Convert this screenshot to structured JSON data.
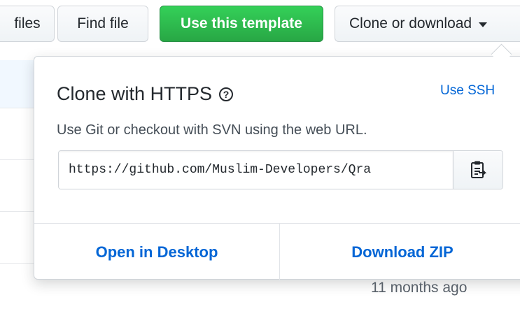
{
  "toolbar": {
    "files_label": "files",
    "find_file_label": "Find file",
    "use_template_label": "Use this template",
    "clone_label": "Clone or download",
    "clone_icon": "caret-down-icon"
  },
  "clone_popover": {
    "title": "Clone with HTTPS",
    "help_icon": "question-circle-icon",
    "help_glyph": "?",
    "use_ssh_label": "Use SSH",
    "description": "Use Git or checkout with SVN using the web URL.",
    "url_value": "https://github.com/Muslim-Developers/Qra",
    "copy_icon": "clipboard-icon",
    "open_desktop_label": "Open in Desktop",
    "download_zip_label": "Download ZIP"
  },
  "background": {
    "timestamp": "11 months ago"
  },
  "colors": {
    "primary_green": "#28a745",
    "link_blue": "#0366d6",
    "border": "#d1d5da"
  }
}
